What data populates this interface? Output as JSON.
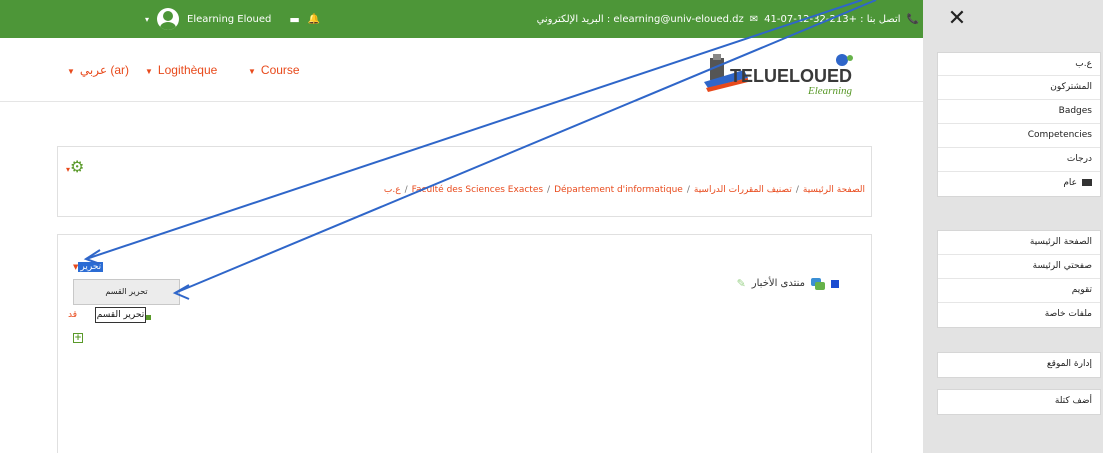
{
  "navbar": {
    "contact": "اتصل بنا : +213-32-12-07-41",
    "email": "elearning@univ-eloued.dz : البريد الإلكتروني",
    "user_name": "Elearning Eloued"
  },
  "header": {
    "menu": [
      {
        "label": "عربي (ar)"
      },
      {
        "label": "Logithèque"
      },
      {
        "label": "Course"
      }
    ],
    "logo_text": "TELUELOUED",
    "logo_sub": "Elearning"
  },
  "breadcrumb": [
    "الصفحة الرئيسية",
    "تصنيف المقررات الدراسية",
    "Faculté des Sciences Exactes",
    "Département d'informatique",
    "ع.ب"
  ],
  "content": {
    "edit_toggle": "تحرير",
    "edit_menu_item": "تحرير القسم",
    "tooltip": "تحرير القسم",
    "fragment": "قد",
    "forum_label": "منتدى الأخبار"
  },
  "sidebar": {
    "block1": [
      "ع.ب",
      "المشتركون",
      "Badges",
      "Competencies",
      "درجات",
      "عام"
    ],
    "block2": [
      "الصفحة الرئيسية",
      "صفحتي الرئيسة",
      "تقويم",
      "ملفات خاصة"
    ],
    "block3": [
      "إدارة الموقع"
    ],
    "block4": [
      "أضف كتلة"
    ]
  },
  "colors": {
    "navbar": "#4d9638",
    "accent": "#e84a1c",
    "arrow": "#2f66c9"
  }
}
